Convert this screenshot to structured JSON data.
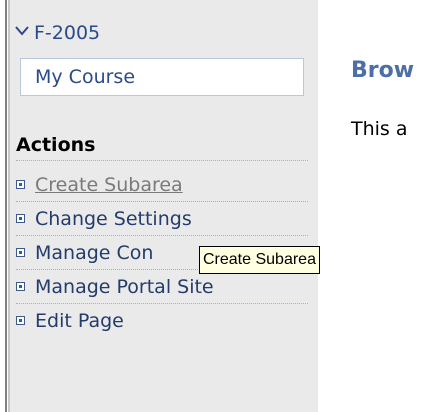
{
  "nav": {
    "area": "F-2005",
    "subarea": "My Course"
  },
  "actions": {
    "heading": "Actions",
    "items": [
      "Create Subarea",
      "Change Settings",
      "Manage Con",
      "Manage Portal Site",
      "Edit Page"
    ]
  },
  "tooltip": {
    "text": "Create Subarea"
  },
  "main": {
    "title": "Brow",
    "description": "This a"
  },
  "colors": {
    "sidebar_bg": "#eaeaea",
    "link": "#243c6b",
    "visited_link": "#7a7a7a",
    "title": "#4e6fa6",
    "tooltip_bg": "#ffffe1"
  }
}
